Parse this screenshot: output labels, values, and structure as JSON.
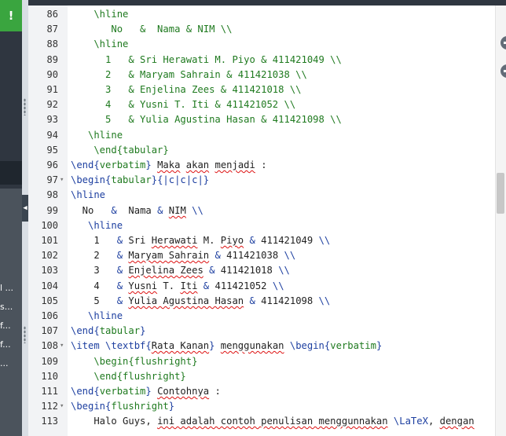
{
  "app": {
    "badge": "!"
  },
  "sidebar": {
    "truncated_items": [
      "l ...",
      "s...",
      "f...",
      "f...",
      "..."
    ]
  },
  "editor": {
    "lines": [
      {
        "n": "86",
        "fold": false,
        "segs": [
          [
            "t-green",
            "    \\hline"
          ]
        ]
      },
      {
        "n": "87",
        "fold": false,
        "segs": [
          [
            "t-green",
            "       No   &  Nama & NIM \\\\"
          ]
        ]
      },
      {
        "n": "88",
        "fold": false,
        "segs": [
          [
            "t-green",
            "    \\hline"
          ]
        ]
      },
      {
        "n": "89",
        "fold": false,
        "segs": [
          [
            "t-green",
            "      1   & Sri Herawati M. Piyo & 411421049 \\\\"
          ]
        ]
      },
      {
        "n": "90",
        "fold": false,
        "segs": [
          [
            "t-green",
            "      2   & Maryam Sahrain & 411421038 \\\\"
          ]
        ]
      },
      {
        "n": "91",
        "fold": false,
        "segs": [
          [
            "t-green",
            "      3   & Enjelina Zees & 411421018 \\\\"
          ]
        ]
      },
      {
        "n": "92",
        "fold": false,
        "segs": [
          [
            "t-green",
            "      4   & Yusni T. Iti & 411421052 \\\\"
          ]
        ]
      },
      {
        "n": "93",
        "fold": false,
        "segs": [
          [
            "t-green",
            "      5   & Yulia Agustina Hasan & 411421098 \\\\"
          ]
        ]
      },
      {
        "n": "94",
        "fold": false,
        "segs": [
          [
            "t-green",
            "   \\hline"
          ]
        ]
      },
      {
        "n": "95",
        "fold": false,
        "segs": [
          [
            "t-green",
            "    \\end{tabular}"
          ]
        ]
      },
      {
        "n": "96",
        "fold": false,
        "segs": [
          [
            "t-cmd",
            "\\end{"
          ],
          [
            "t-green",
            "verbatim"
          ],
          [
            "t-cmd",
            "}"
          ],
          [
            "t-dark",
            " "
          ],
          [
            "t-dark sq",
            "Maka"
          ],
          [
            "t-dark",
            " "
          ],
          [
            "t-dark sq",
            "akan"
          ],
          [
            "t-dark",
            " "
          ],
          [
            "t-dark sq",
            "menjadi"
          ],
          [
            "t-dark",
            " :"
          ]
        ]
      },
      {
        "n": "97",
        "fold": true,
        "segs": [
          [
            "t-cmd",
            "\\begin{"
          ],
          [
            "t-green",
            "tabular"
          ],
          [
            "t-cmd",
            "}{|c|c|c|}"
          ]
        ]
      },
      {
        "n": "98",
        "fold": false,
        "segs": [
          [
            "t-cmd",
            "\\hline"
          ]
        ]
      },
      {
        "n": "99",
        "fold": false,
        "segs": [
          [
            "t-dark",
            "  No   "
          ],
          [
            "t-cmd",
            "&"
          ],
          [
            "t-dark",
            "  Nama "
          ],
          [
            "t-cmd",
            "&"
          ],
          [
            "t-dark",
            " "
          ],
          [
            "t-dark sq",
            "NIM"
          ],
          [
            "t-dark",
            " "
          ],
          [
            "t-cmd",
            "\\\\"
          ]
        ]
      },
      {
        "n": "100",
        "fold": false,
        "segs": [
          [
            "t-cmd",
            "   \\hline"
          ]
        ]
      },
      {
        "n": "101",
        "fold": false,
        "segs": [
          [
            "t-dark",
            "    1   "
          ],
          [
            "t-cmd",
            "&"
          ],
          [
            "t-dark",
            " Sri "
          ],
          [
            "t-dark sq",
            "Herawati"
          ],
          [
            "t-dark",
            " M. "
          ],
          [
            "t-dark sq",
            "Piyo"
          ],
          [
            "t-dark",
            " "
          ],
          [
            "t-cmd",
            "&"
          ],
          [
            "t-dark",
            " 411421049 "
          ],
          [
            "t-cmd",
            "\\\\"
          ]
        ]
      },
      {
        "n": "102",
        "fold": false,
        "segs": [
          [
            "t-dark",
            "    2   "
          ],
          [
            "t-cmd",
            "&"
          ],
          [
            "t-dark",
            " "
          ],
          [
            "t-dark sq",
            "Maryam Sahrain"
          ],
          [
            "t-dark",
            " "
          ],
          [
            "t-cmd",
            "&"
          ],
          [
            "t-dark",
            " 411421038 "
          ],
          [
            "t-cmd",
            "\\\\"
          ]
        ]
      },
      {
        "n": "103",
        "fold": false,
        "segs": [
          [
            "t-dark",
            "    3   "
          ],
          [
            "t-cmd",
            "&"
          ],
          [
            "t-dark",
            " "
          ],
          [
            "t-dark sq",
            "Enjelina Zees"
          ],
          [
            "t-dark",
            " "
          ],
          [
            "t-cmd",
            "&"
          ],
          [
            "t-dark",
            " 411421018 "
          ],
          [
            "t-cmd",
            "\\\\"
          ]
        ]
      },
      {
        "n": "104",
        "fold": false,
        "segs": [
          [
            "t-dark",
            "    4   "
          ],
          [
            "t-cmd",
            "&"
          ],
          [
            "t-dark",
            " "
          ],
          [
            "t-dark sq",
            "Yusni"
          ],
          [
            "t-dark",
            " T. "
          ],
          [
            "t-dark sq",
            "Iti"
          ],
          [
            "t-dark",
            " "
          ],
          [
            "t-cmd",
            "&"
          ],
          [
            "t-dark",
            " 411421052 "
          ],
          [
            "t-cmd",
            "\\\\"
          ]
        ]
      },
      {
        "n": "105",
        "fold": false,
        "segs": [
          [
            "t-dark",
            "    5   "
          ],
          [
            "t-cmd",
            "&"
          ],
          [
            "t-dark",
            " "
          ],
          [
            "t-dark sq",
            "Yulia Agustina Hasan"
          ],
          [
            "t-dark",
            " "
          ],
          [
            "t-cmd",
            "&"
          ],
          [
            "t-dark",
            " 411421098 "
          ],
          [
            "t-cmd",
            "\\\\"
          ]
        ]
      },
      {
        "n": "106",
        "fold": false,
        "segs": [
          [
            "t-cmd",
            "   \\hline"
          ]
        ]
      },
      {
        "n": "107",
        "fold": false,
        "segs": [
          [
            "t-cmd",
            "\\end{"
          ],
          [
            "t-green",
            "tabular"
          ],
          [
            "t-cmd",
            "}"
          ]
        ]
      },
      {
        "n": "108",
        "fold": true,
        "segs": [
          [
            "t-cmd",
            "\\item \\textbf{"
          ],
          [
            "t-dark sq",
            "Rata Kanan"
          ],
          [
            "t-cmd",
            "}"
          ],
          [
            "t-dark",
            " "
          ],
          [
            "t-dark sq",
            "menggunakan"
          ],
          [
            "t-dark",
            " "
          ],
          [
            "t-cmd",
            "\\begin{"
          ],
          [
            "t-green",
            "verbatim"
          ],
          [
            "t-cmd",
            "}"
          ]
        ]
      },
      {
        "n": "109",
        "fold": false,
        "segs": [
          [
            "t-green",
            "    \\begin{flushright}"
          ]
        ]
      },
      {
        "n": "110",
        "fold": false,
        "segs": [
          [
            "t-green",
            "    \\end{flushright}"
          ]
        ]
      },
      {
        "n": "111",
        "fold": false,
        "segs": [
          [
            "t-cmd",
            "\\end{"
          ],
          [
            "t-green",
            "verbatim"
          ],
          [
            "t-cmd",
            "}"
          ],
          [
            "t-dark",
            " "
          ],
          [
            "t-dark sq",
            "Contohnya"
          ],
          [
            "t-dark",
            " :"
          ]
        ]
      },
      {
        "n": "112",
        "fold": true,
        "segs": [
          [
            "t-cmd",
            "\\begin{"
          ],
          [
            "t-green",
            "flushright"
          ],
          [
            "t-cmd",
            "}"
          ]
        ]
      },
      {
        "n": "113",
        "fold": false,
        "segs": [
          [
            "t-dark",
            "    Halo Guys, "
          ],
          [
            "t-dark sq",
            "ini adalah contoh penulisan menggunnakan"
          ],
          [
            "t-dark",
            " "
          ],
          [
            "t-cmd",
            "\\LaTeX"
          ],
          [
            "t-dark",
            ", "
          ],
          [
            "t-dark sq",
            "dengan"
          ]
        ]
      }
    ]
  }
}
